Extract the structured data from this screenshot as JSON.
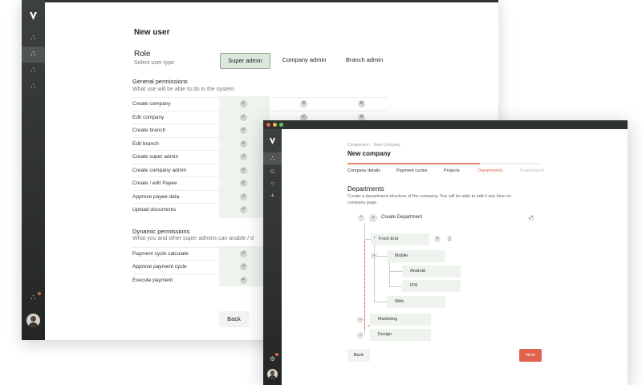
{
  "colors": {
    "accent": "#e0624f",
    "sidebar": "#2e3230",
    "selected_bg": "#dce8dc",
    "check_bg": "#c9d5c9"
  },
  "back_window": {
    "title": "New user",
    "role": {
      "heading": "Role",
      "subtitle": "Select user type",
      "options": [
        "Super admin",
        "Company admin",
        "Branch admin"
      ],
      "selected": "Super admin"
    },
    "general": {
      "heading": "General permissions",
      "subtitle": "What use will be able to do in the system",
      "rows": [
        {
          "label": "Create company",
          "values": [
            "check",
            "cross",
            "cross"
          ]
        },
        {
          "label": "Edit company",
          "values": [
            "check",
            "check",
            "cross"
          ]
        },
        {
          "label": "Create branch",
          "values": [
            "check"
          ]
        },
        {
          "label": "Edit branch",
          "values": [
            "check"
          ]
        },
        {
          "label": "Create super admin",
          "values": [
            "check"
          ]
        },
        {
          "label": "Create company admin",
          "values": [
            "check"
          ]
        },
        {
          "label": "Create / edit Payee",
          "values": [
            "check"
          ]
        },
        {
          "label": "Approve payee data",
          "values": [
            "check"
          ]
        },
        {
          "label": "Upload documents",
          "values": [
            "check"
          ]
        }
      ]
    },
    "dynamic": {
      "heading": "Dynamic permissions",
      "subtitle": "What you and other super admins can anable / d",
      "rows": [
        {
          "label": "Payment cycle calculate",
          "values": [
            "check"
          ]
        },
        {
          "label": "Approve payment cycle",
          "values": [
            "check"
          ]
        },
        {
          "label": "Execute payment",
          "values": [
            "check"
          ]
        }
      ]
    },
    "back_label": "Back"
  },
  "front_window": {
    "breadcrumb": [
      "Companies",
      "/",
      "New Company"
    ],
    "title": "New company",
    "steps": [
      "Company details",
      "Payment cycles",
      "Projects",
      "Departments",
      "Final branch"
    ],
    "active_step": "Departments",
    "departments": {
      "heading": "Departments",
      "subtitle": "Create a department structure of the company. You will be able to edit it any time on company page.",
      "create_label": "Create Department",
      "nodes": [
        "Front End",
        "Mobile",
        "Android",
        "IOS",
        "Web",
        "Marketing",
        "Design"
      ]
    },
    "back_label": "Back",
    "next_label": "Next"
  },
  "icons": [
    "logo-icon",
    "share-icon",
    "user-icon",
    "search-icon",
    "plus-icon",
    "expand-icon",
    "trash-icon",
    "avatar"
  ]
}
